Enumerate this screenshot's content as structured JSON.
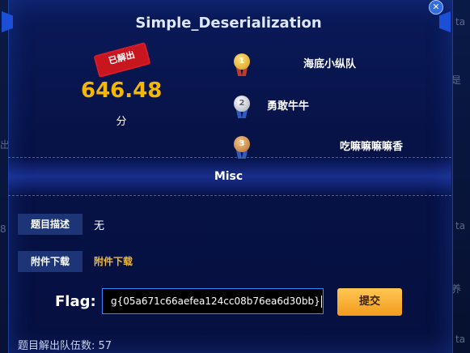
{
  "challenge": {
    "title": "Simple_Deserialization",
    "solved_stamp": "已解出",
    "score": "646.48",
    "score_unit": "分",
    "category": "Misc"
  },
  "ranking": [
    {
      "rank": "1",
      "team": "海底小纵队",
      "medal": "gold"
    },
    {
      "rank": "2",
      "team": "勇敢牛牛",
      "medal": "silver"
    },
    {
      "rank": "3",
      "team": "吃嘛嘛嘛嘛香",
      "medal": "bronze"
    }
  ],
  "details": {
    "description_label": "题目描述",
    "description_value": "无",
    "attachment_label": "附件下载",
    "attachment_link": "附件下载"
  },
  "flag": {
    "label": "Flag:",
    "input_value": "g{05a671c66aefea124cc08b76ea6d30bb}",
    "submit_label": "提交"
  },
  "footer": {
    "solves_text": "题目解出队伍数: 57"
  },
  "background": {
    "right_fragments": [
      "ta",
      "是",
      "ta",
      "养",
      "ta"
    ],
    "left_fragments": [
      "出",
      "8"
    ]
  },
  "colors": {
    "score": "#f5b700",
    "stamp": "#c8161f",
    "link": "#f2b92f",
    "submit": "#f7ad32",
    "input_border": "#3a86ff"
  }
}
